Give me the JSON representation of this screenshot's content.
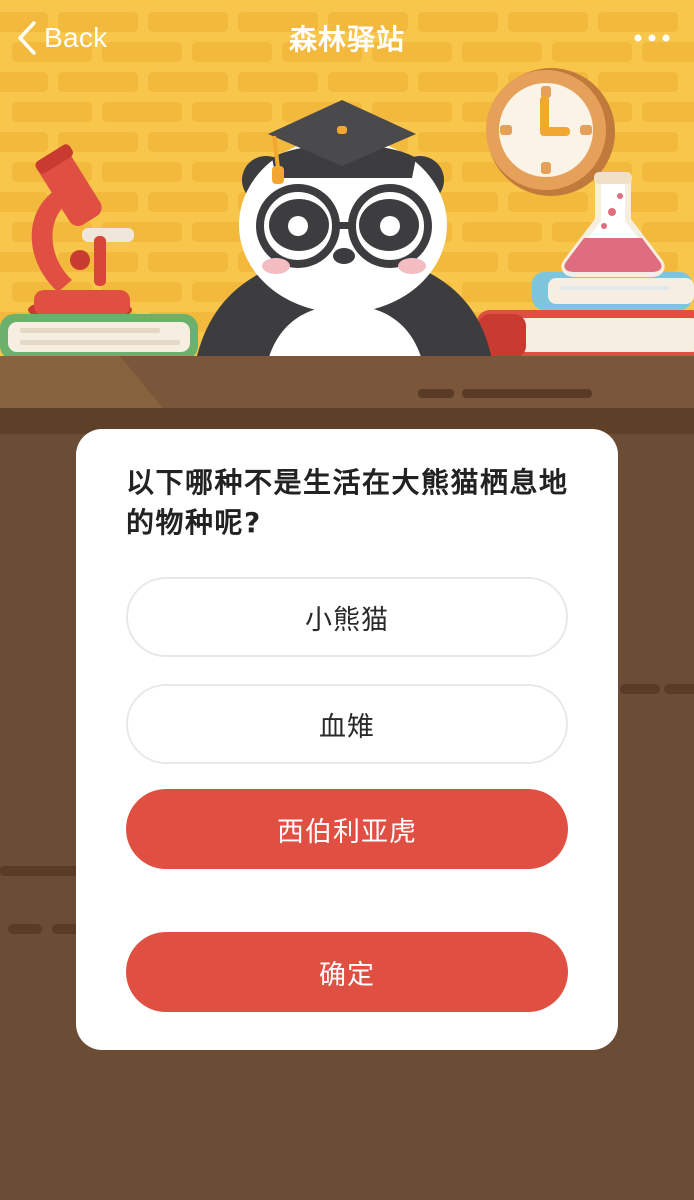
{
  "nav": {
    "back_label": "Back",
    "title": "森林驿站"
  },
  "quiz": {
    "question": "以下哪种不是生活在大熊猫栖息地的物种呢?",
    "options": [
      {
        "label": "小熊猫",
        "selected": false
      },
      {
        "label": "血雉",
        "selected": false
      },
      {
        "label": "西伯利亚虎",
        "selected": true
      }
    ],
    "confirm_label": "确定"
  },
  "colors": {
    "wall_yellow": "#f7c64a",
    "desk_brown": "#7a573b",
    "accent_red": "#e05042",
    "card_white": "#ffffff"
  },
  "icons": {
    "back": "chevron-left-icon",
    "more": "more-dots-icon"
  }
}
